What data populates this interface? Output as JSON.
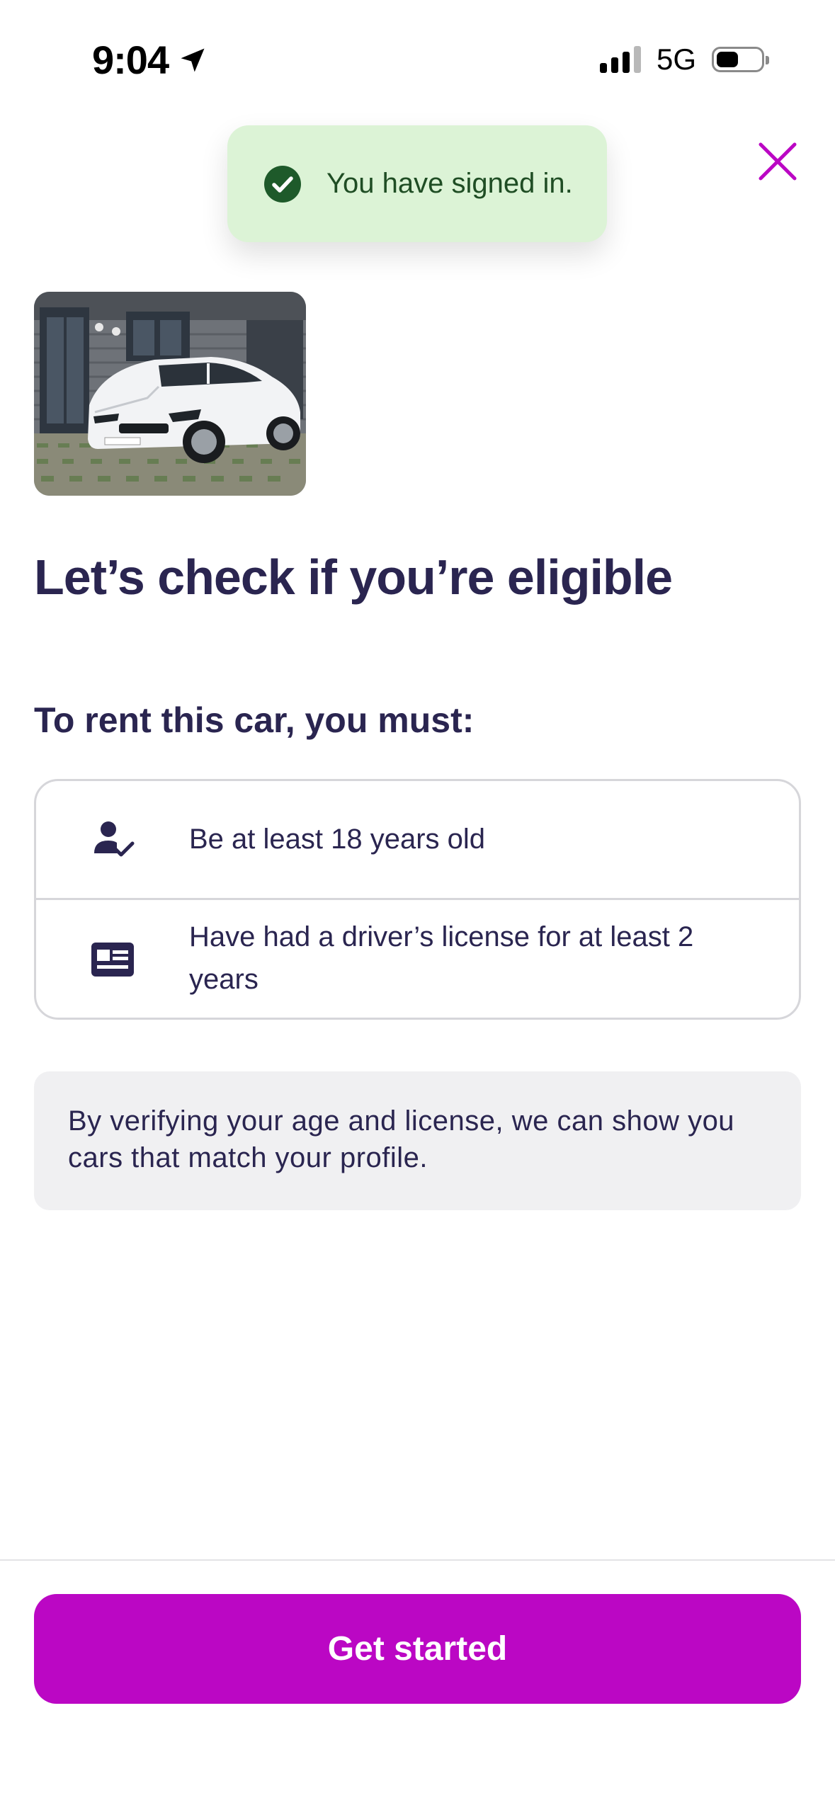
{
  "status_bar": {
    "time": "9:04",
    "network": "5G",
    "location_icon": "location-arrow-icon",
    "signal_icon": "cellular-signal-icon",
    "battery_icon": "battery-icon"
  },
  "toast": {
    "icon": "check-circle-icon",
    "message": "You have signed in."
  },
  "header": {
    "close_icon": "close-icon"
  },
  "car": {
    "image_icon": "car-photo"
  },
  "title": "Let’s check if you’re eligible",
  "requirements": {
    "heading": "To rent this car, you must:",
    "items": [
      {
        "icon": "user-check-icon",
        "text": "Be at least 18 years old"
      },
      {
        "icon": "id-card-icon",
        "text": "Have had a driver’s license for at least 2 years"
      }
    ]
  },
  "info": {
    "text": "By verifying your age and license, we can show you cars that match your profile."
  },
  "cta": {
    "label": "Get started"
  },
  "colors": {
    "brand_accent": "#bb07c4",
    "text_primary": "#2a2550",
    "toast_bg": "#dcf3d6",
    "toast_text": "#1f4d24",
    "info_bg": "#f0f0f2",
    "border": "#d6d6da"
  }
}
